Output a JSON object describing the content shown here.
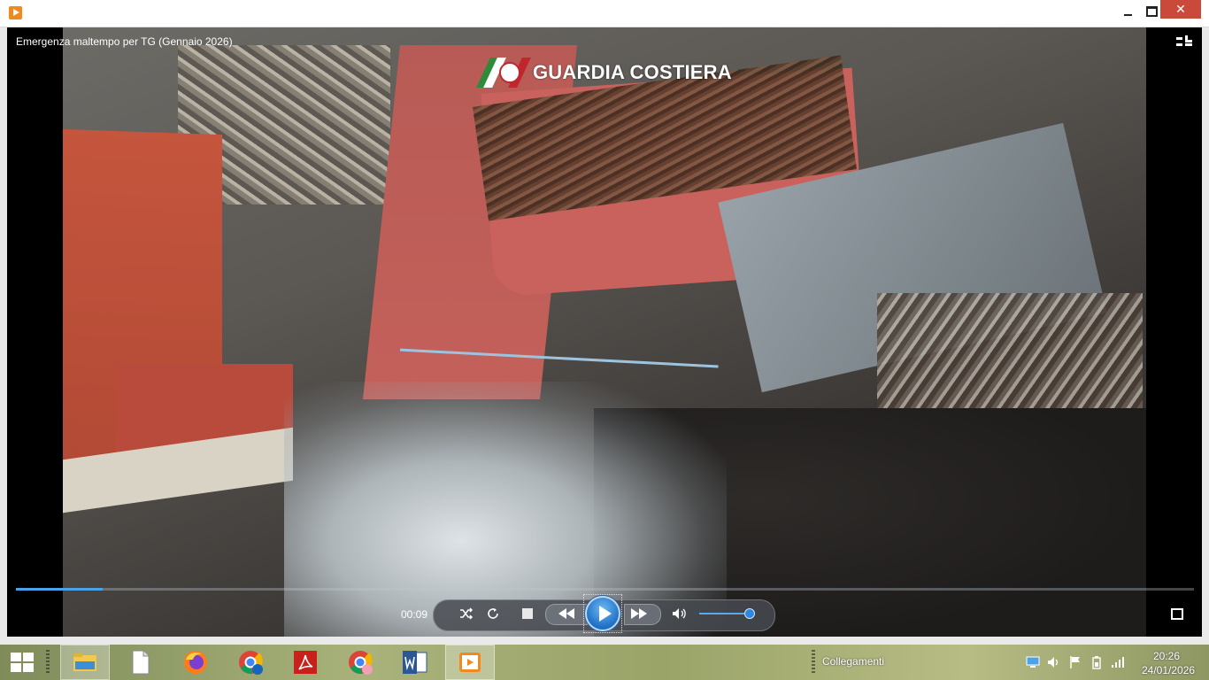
{
  "window": {
    "title_icon": "media-player-icon",
    "controls": {
      "minimize": "minimize-icon",
      "maximize": "maximize-icon",
      "close": "✕"
    }
  },
  "video": {
    "title": "Emergenza maltempo per TG (Gennaio 2026)",
    "watermark": "GUARDIA COSTIERA",
    "elapsed": "00:09",
    "progress_fraction": 0.074,
    "volume_fraction": 0.9
  },
  "taskbar": {
    "items": [
      {
        "name": "file-explorer",
        "icon": "folder-icon",
        "active": false
      },
      {
        "name": "blank-document",
        "icon": "document-icon",
        "active": false
      },
      {
        "name": "firefox",
        "icon": "firefox-icon",
        "active": false
      },
      {
        "name": "chrome-profile-t",
        "icon": "chrome-icon",
        "active": false
      },
      {
        "name": "acrobat",
        "icon": "pdf-icon",
        "active": false
      },
      {
        "name": "chrome-profile-2",
        "icon": "chrome-icon",
        "active": false
      },
      {
        "name": "word",
        "icon": "word-icon",
        "active": false
      },
      {
        "name": "media-player",
        "icon": "media-player-icon",
        "active": true
      }
    ],
    "toolbar_label": "Collegamenti",
    "clock_time": "20:26",
    "clock_date": "24/01/2026"
  },
  "colors": {
    "accent": "#2f86dc",
    "close_button": "#c94a3b",
    "logo_red": "#c0272d",
    "logo_green": "#2e8b3a"
  }
}
